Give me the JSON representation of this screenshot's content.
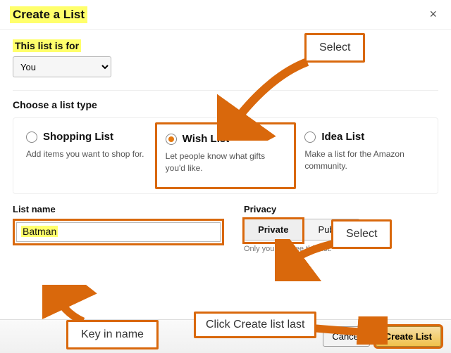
{
  "header": {
    "title": "Create a List"
  },
  "listFor": {
    "label": "This list is for",
    "options": [
      "You"
    ],
    "selected": "You"
  },
  "typeSection": {
    "heading": "Choose a list type",
    "cards": [
      {
        "title": "Shopping List",
        "desc": "Add items you want to shop for.",
        "selected": false
      },
      {
        "title": "Wish List",
        "desc": "Let people know what gifts you'd like.",
        "selected": true
      },
      {
        "title": "Idea List",
        "desc": "Make a list for the Amazon community.",
        "selected": false
      }
    ]
  },
  "listName": {
    "label": "List name",
    "value": "Batman"
  },
  "privacy": {
    "label": "Privacy",
    "options": [
      "Private",
      "Public"
    ],
    "selected": "Private",
    "note": "Only you can see this list."
  },
  "footer": {
    "cancel": "Cancel",
    "create": "Create List"
  },
  "annotations": {
    "selectTop": "Select",
    "selectPrivacy": "Select",
    "keyInName": "Key in name",
    "clickLast": "Click Create list last"
  }
}
